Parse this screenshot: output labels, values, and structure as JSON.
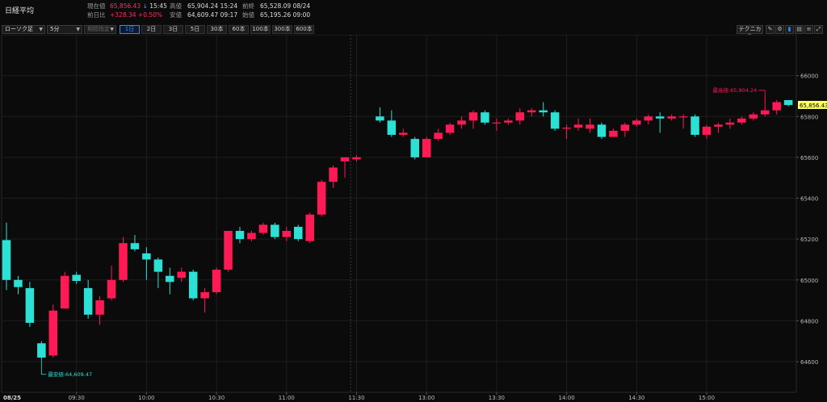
{
  "header": {
    "title": "日経平均",
    "quote": {
      "current_label": "現在値",
      "current_value": "65,856.43",
      "current_arrow": "↓",
      "current_time": "15:45",
      "change_label": "前日比",
      "change_value": "+328.34",
      "change_pct": "+0.50%",
      "high_label": "高値",
      "high_value": "65,904.24",
      "high_time": "15:24",
      "low_label": "安値",
      "low_value": "64,609.47",
      "low_time": "09:17",
      "prev_close_label": "前終",
      "prev_close_value": "65,528.09",
      "prev_close_date": "08/24",
      "open_label": "始値",
      "open_value": "65,195.26",
      "open_time": "09:00"
    }
  },
  "toolbar": {
    "chart_type": "ローソク足",
    "interval": "5分",
    "period_select": "期間指定",
    "periods": [
      "1日",
      "2日",
      "3日",
      "5日",
      "30本",
      "60本",
      "100本",
      "300本",
      "600本"
    ],
    "active_period": "1日",
    "technical_label": "テクニカル",
    "icons": [
      "pencil-icon",
      "gear-icon",
      "chart-icon",
      "expand-icon"
    ]
  },
  "colors": {
    "up": "#ff1a55",
    "down": "#2de0d6",
    "grid": "#1e1e1e",
    "current_price_bg": "#ffff66"
  },
  "chart_data": {
    "type": "candlestick",
    "title": "",
    "date_label": "08/25",
    "ylim": [
      64450,
      66200
    ],
    "yticks": [
      64600,
      64800,
      65000,
      65200,
      65400,
      65600,
      65800,
      66000
    ],
    "xticks": [
      "09:30",
      "10:00",
      "10:30",
      "11:00",
      "11:30",
      "13:00",
      "13:30",
      "14:00",
      "14:30",
      "15:00"
    ],
    "tick_slots": [
      6,
      12,
      18,
      24,
      30,
      36,
      42,
      48,
      54,
      60
    ],
    "session_break_slot": 30,
    "current_price_label": "65,856.43",
    "high_annotation": "最高値:65,904.24",
    "low_annotation": "最安値:64,609.47",
    "high_candle_index": 64,
    "low_candle_index": 3,
    "candles": [
      {
        "o": 65195,
        "h": 65280,
        "l": 64950,
        "c": 65000
      },
      {
        "o": 65000,
        "h": 65020,
        "l": 64930,
        "c": 64965
      },
      {
        "o": 64960,
        "h": 64990,
        "l": 64770,
        "c": 64790
      },
      {
        "o": 64690,
        "h": 64700,
        "l": 64609,
        "c": 64620
      },
      {
        "o": 64630,
        "h": 64880,
        "l": 64620,
        "c": 64850
      },
      {
        "o": 64860,
        "h": 65040,
        "l": 64860,
        "c": 65020
      },
      {
        "o": 65025,
        "h": 65040,
        "l": 64980,
        "c": 64995
      },
      {
        "o": 64960,
        "h": 65000,
        "l": 64810,
        "c": 64830
      },
      {
        "o": 64830,
        "h": 64920,
        "l": 64780,
        "c": 64900
      },
      {
        "o": 64910,
        "h": 65070,
        "l": 64900,
        "c": 65000
      },
      {
        "o": 65000,
        "h": 65210,
        "l": 64990,
        "c": 65180
      },
      {
        "o": 65180,
        "h": 65220,
        "l": 65140,
        "c": 65150
      },
      {
        "o": 65130,
        "h": 65160,
        "l": 65000,
        "c": 65100
      },
      {
        "o": 65100,
        "h": 65110,
        "l": 64960,
        "c": 65040
      },
      {
        "o": 65020,
        "h": 65060,
        "l": 64930,
        "c": 64990
      },
      {
        "o": 65010,
        "h": 65060,
        "l": 64990,
        "c": 65040
      },
      {
        "o": 65040,
        "h": 65050,
        "l": 64900,
        "c": 64910
      },
      {
        "o": 64910,
        "h": 64960,
        "l": 64840,
        "c": 64940
      },
      {
        "o": 64940,
        "h": 65060,
        "l": 64930,
        "c": 65050
      },
      {
        "o": 65050,
        "h": 65240,
        "l": 65040,
        "c": 65240
      },
      {
        "o": 65240,
        "h": 65260,
        "l": 65180,
        "c": 65200
      },
      {
        "o": 65200,
        "h": 65240,
        "l": 65190,
        "c": 65230
      },
      {
        "o": 65230,
        "h": 65280,
        "l": 65220,
        "c": 65270
      },
      {
        "o": 65270,
        "h": 65280,
        "l": 65200,
        "c": 65210
      },
      {
        "o": 65210,
        "h": 65260,
        "l": 65190,
        "c": 65240
      },
      {
        "o": 65260,
        "h": 65270,
        "l": 65190,
        "c": 65200
      },
      {
        "o": 65190,
        "h": 65330,
        "l": 65180,
        "c": 65320
      },
      {
        "o": 65320,
        "h": 65490,
        "l": 65310,
        "c": 65480
      },
      {
        "o": 65480,
        "h": 65560,
        "l": 65450,
        "c": 65550
      },
      {
        "o": 65580,
        "h": 65600,
        "l": 65500,
        "c": 65600
      },
      {
        "o": 65590,
        "h": 65610,
        "l": 65580,
        "c": 65600
      },
      {
        "o": 65800,
        "h": 65845,
        "l": 65770,
        "c": 65780
      },
      {
        "o": 65780,
        "h": 65830,
        "l": 65700,
        "c": 65710
      },
      {
        "o": 65710,
        "h": 65740,
        "l": 65700,
        "c": 65720
      },
      {
        "o": 65690,
        "h": 65700,
        "l": 65590,
        "c": 65600
      },
      {
        "o": 65600,
        "h": 65700,
        "l": 65600,
        "c": 65690
      },
      {
        "o": 65690,
        "h": 65740,
        "l": 65680,
        "c": 65720
      },
      {
        "o": 65720,
        "h": 65770,
        "l": 65710,
        "c": 65760
      },
      {
        "o": 65760,
        "h": 65800,
        "l": 65740,
        "c": 65780
      },
      {
        "o": 65780,
        "h": 65830,
        "l": 65740,
        "c": 65820
      },
      {
        "o": 65820,
        "h": 65830,
        "l": 65760,
        "c": 65770
      },
      {
        "o": 65770,
        "h": 65790,
        "l": 65730,
        "c": 65770
      },
      {
        "o": 65770,
        "h": 65790,
        "l": 65760,
        "c": 65780
      },
      {
        "o": 65780,
        "h": 65840,
        "l": 65760,
        "c": 65820
      },
      {
        "o": 65820,
        "h": 65840,
        "l": 65800,
        "c": 65830
      },
      {
        "o": 65830,
        "h": 65870,
        "l": 65800,
        "c": 65820
      },
      {
        "o": 65820,
        "h": 65830,
        "l": 65730,
        "c": 65740
      },
      {
        "o": 65740,
        "h": 65760,
        "l": 65690,
        "c": 65745
      },
      {
        "o": 65745,
        "h": 65790,
        "l": 65730,
        "c": 65760
      },
      {
        "o": 65740,
        "h": 65790,
        "l": 65720,
        "c": 65760
      },
      {
        "o": 65760,
        "h": 65770,
        "l": 65690,
        "c": 65700
      },
      {
        "o": 65700,
        "h": 65740,
        "l": 65700,
        "c": 65730
      },
      {
        "o": 65730,
        "h": 65770,
        "l": 65700,
        "c": 65760
      },
      {
        "o": 65760,
        "h": 65790,
        "l": 65750,
        "c": 65780
      },
      {
        "o": 65780,
        "h": 65810,
        "l": 65760,
        "c": 65800
      },
      {
        "o": 65800,
        "h": 65820,
        "l": 65720,
        "c": 65790
      },
      {
        "o": 65790,
        "h": 65810,
        "l": 65780,
        "c": 65800
      },
      {
        "o": 65800,
        "h": 65810,
        "l": 65740,
        "c": 65800
      },
      {
        "o": 65800,
        "h": 65810,
        "l": 65700,
        "c": 65710
      },
      {
        "o": 65710,
        "h": 65760,
        "l": 65690,
        "c": 65750
      },
      {
        "o": 65750,
        "h": 65770,
        "l": 65720,
        "c": 65760
      },
      {
        "o": 65760,
        "h": 65790,
        "l": 65740,
        "c": 65770
      },
      {
        "o": 65770,
        "h": 65800,
        "l": 65760,
        "c": 65790
      },
      {
        "o": 65790,
        "h": 65820,
        "l": 65780,
        "c": 65810
      },
      {
        "o": 65810,
        "h": 65904,
        "l": 65800,
        "c": 65830
      },
      {
        "o": 65830,
        "h": 65880,
        "l": 65810,
        "c": 65870
      },
      {
        "o": 65880,
        "h": 65880,
        "l": 65850,
        "c": 65856
      }
    ]
  }
}
